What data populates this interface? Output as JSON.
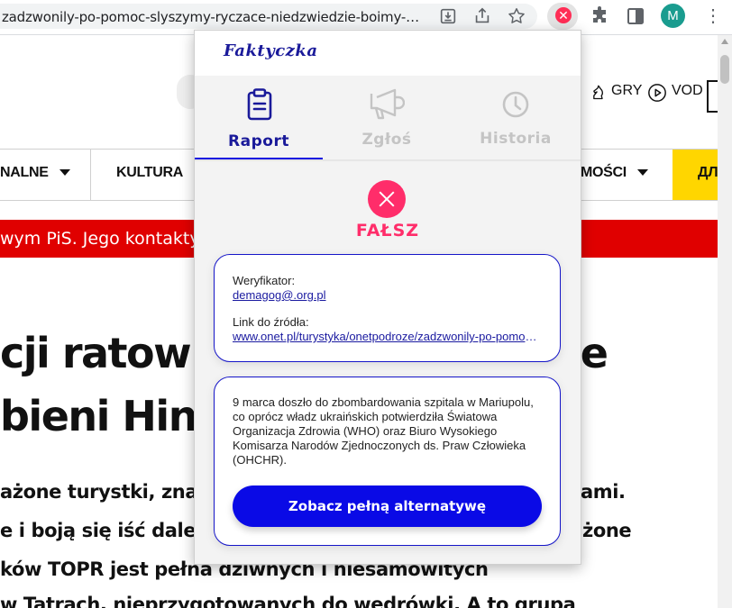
{
  "browser": {
    "url": "zadzwonily-po-pomoc-slyszymy-ryczace-niedzwiedzie-boimy-sie/...",
    "avatar_letter": "M"
  },
  "site": {
    "header_links": [
      {
        "label": "GRY"
      },
      {
        "label": "VOD"
      }
    ],
    "nav": [
      {
        "label": "NALNE"
      },
      {
        "label": "KULTURA"
      },
      {
        "label": "MOŚCI"
      },
      {
        "label": "ДЛ"
      }
    ],
    "ticker": "wym PiS. Jego kontakty",
    "headline_lines": [
      "cji ratown",
      "bieni Hin"
    ],
    "headline_right": "ce",
    "lead_lines": [
      "ażone turystki, znaj",
      "e i boją się iść dale",
      "ków TOPR jest pełna dziwnych i niesamowitych",
      "w Tatrach, nieprzygotowanych do wędrówki. A to grupa"
    ],
    "lead_right": [
      "ami.",
      "żone"
    ]
  },
  "extension": {
    "logo": "Faktyczka",
    "tabs": [
      {
        "label": "Raport",
        "icon": "clipboard-icon",
        "active": true
      },
      {
        "label": "Zgłoś",
        "icon": "megaphone-icon",
        "active": false
      },
      {
        "label": "Historia",
        "icon": "clock-icon",
        "active": false
      }
    ],
    "verdict": "FAŁSZ",
    "verifier_label": "Weryfikator:",
    "verifier_value": "demagog@.org.pl",
    "source_label": "Link do źródła:",
    "source_value": "www.onet.pl/turystyka/onetpodroze/zadzwonily-po-pomoc-slyszymy-ryczace-niedzwiedzie-boimy-sie",
    "alternative_text": "9 marca doszło do zbombardowania szpitala w Mariupolu, co oprócz władz ukraińskich potwierdziła Światowa Organizacja Zdrowia (WHO) oraz Biuro Wysokiego Komisarza Narodów Zjednoczonych ds. Praw Człowieka (OHCHR).",
    "cta": "Zobacz pełną alternatywę"
  },
  "colors": {
    "accent_blue": "#0a0ae6",
    "brand_navy": "#1a1a9a",
    "false_red": "#ff2d6a",
    "ticker_red": "#e00000",
    "nav_yellow": "#ffd600"
  }
}
